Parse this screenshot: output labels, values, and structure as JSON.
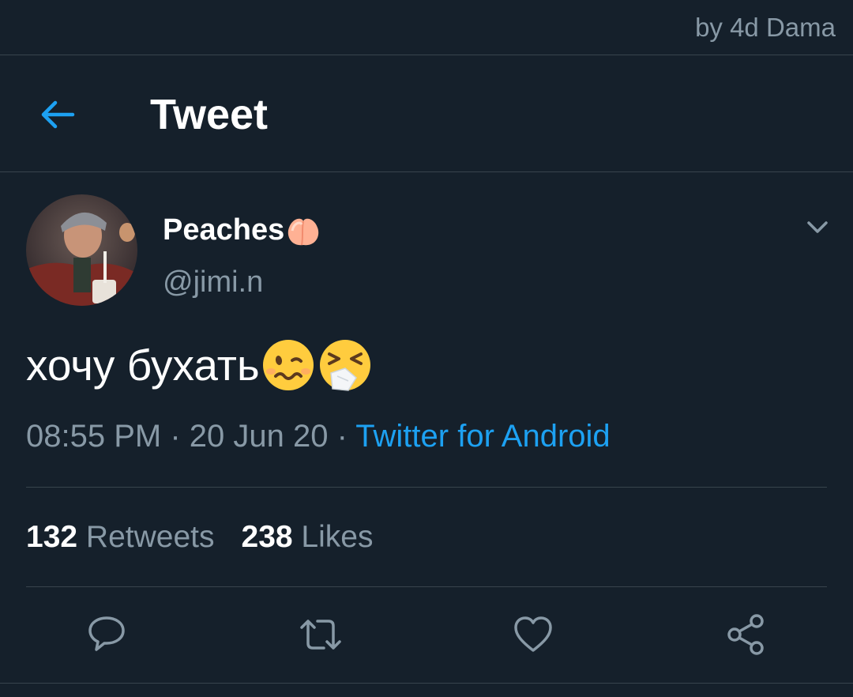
{
  "watermark": "by 4d Dama",
  "header": {
    "title": "Tweet",
    "back_icon": "arrow-left-icon"
  },
  "tweet": {
    "display_name": "Peaches",
    "name_emoji": "peach-emoji",
    "handle": "@jimi.n",
    "text": "хочу бухать",
    "text_emojis": [
      "woozy-face-emoji",
      "sneezing-face-emoji"
    ],
    "time": "08:55 PM",
    "separator": " · ",
    "date": "20 Jun 20",
    "source": "Twitter for Android"
  },
  "stats": {
    "retweets_count": "132",
    "retweets_label": "Retweets",
    "likes_count": "238",
    "likes_label": "Likes"
  },
  "actions": [
    "reply-icon",
    "retweet-icon",
    "like-icon",
    "share-icon"
  ],
  "colors": {
    "background": "#15202b",
    "accent": "#1da1f2",
    "secondary_text": "#8899a6",
    "divider": "#38444d"
  }
}
